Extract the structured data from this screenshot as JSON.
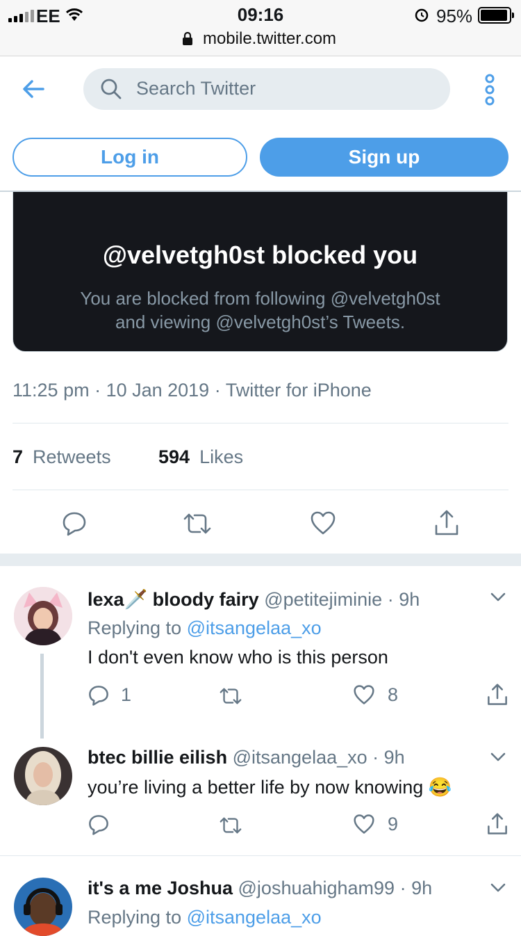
{
  "status_bar": {
    "carrier": "EE",
    "time": "09:16",
    "battery": "95%",
    "url": "mobile.twitter.com"
  },
  "header": {
    "search_placeholder": "Search Twitter",
    "login_label": "Log in",
    "signup_label": "Sign up"
  },
  "blocked": {
    "title": "@velvetgh0st blocked you",
    "line1": "You are blocked from following @velvetgh0st",
    "line2": "and viewing @velvetgh0st’s Tweets."
  },
  "tweet_meta": "11:25 pm · 10 Jan 2019 · Twitter for iPhone",
  "stats": {
    "retweets_count": "7",
    "retweets_label": "Retweets",
    "likes_count": "594",
    "likes_label": "Likes"
  },
  "replies": [
    {
      "name": "lexa🗡️ bloody fairy",
      "handle": "@petitejiminie · 9h",
      "replying_prefix": "Replying to ",
      "replying_to": "@itsangelaa_xo",
      "text": "I don't even know who is this person",
      "reply_count": "1",
      "like_count": "8"
    },
    {
      "name": "btec billie eilish",
      "handle": "@itsangelaa_xo · 9h",
      "text": "you’re living a better life by now knowing 😂",
      "reply_count": "",
      "like_count": "9"
    },
    {
      "name": "it's a me Joshua",
      "handle": "@joshuahigham99 · 9h",
      "replying_prefix": "Replying to ",
      "replying_to": "@itsangelaa_xo"
    }
  ],
  "colors": {
    "accent": "#4d9ee8",
    "card_bg": "#15171c",
    "muted": "#657786"
  }
}
